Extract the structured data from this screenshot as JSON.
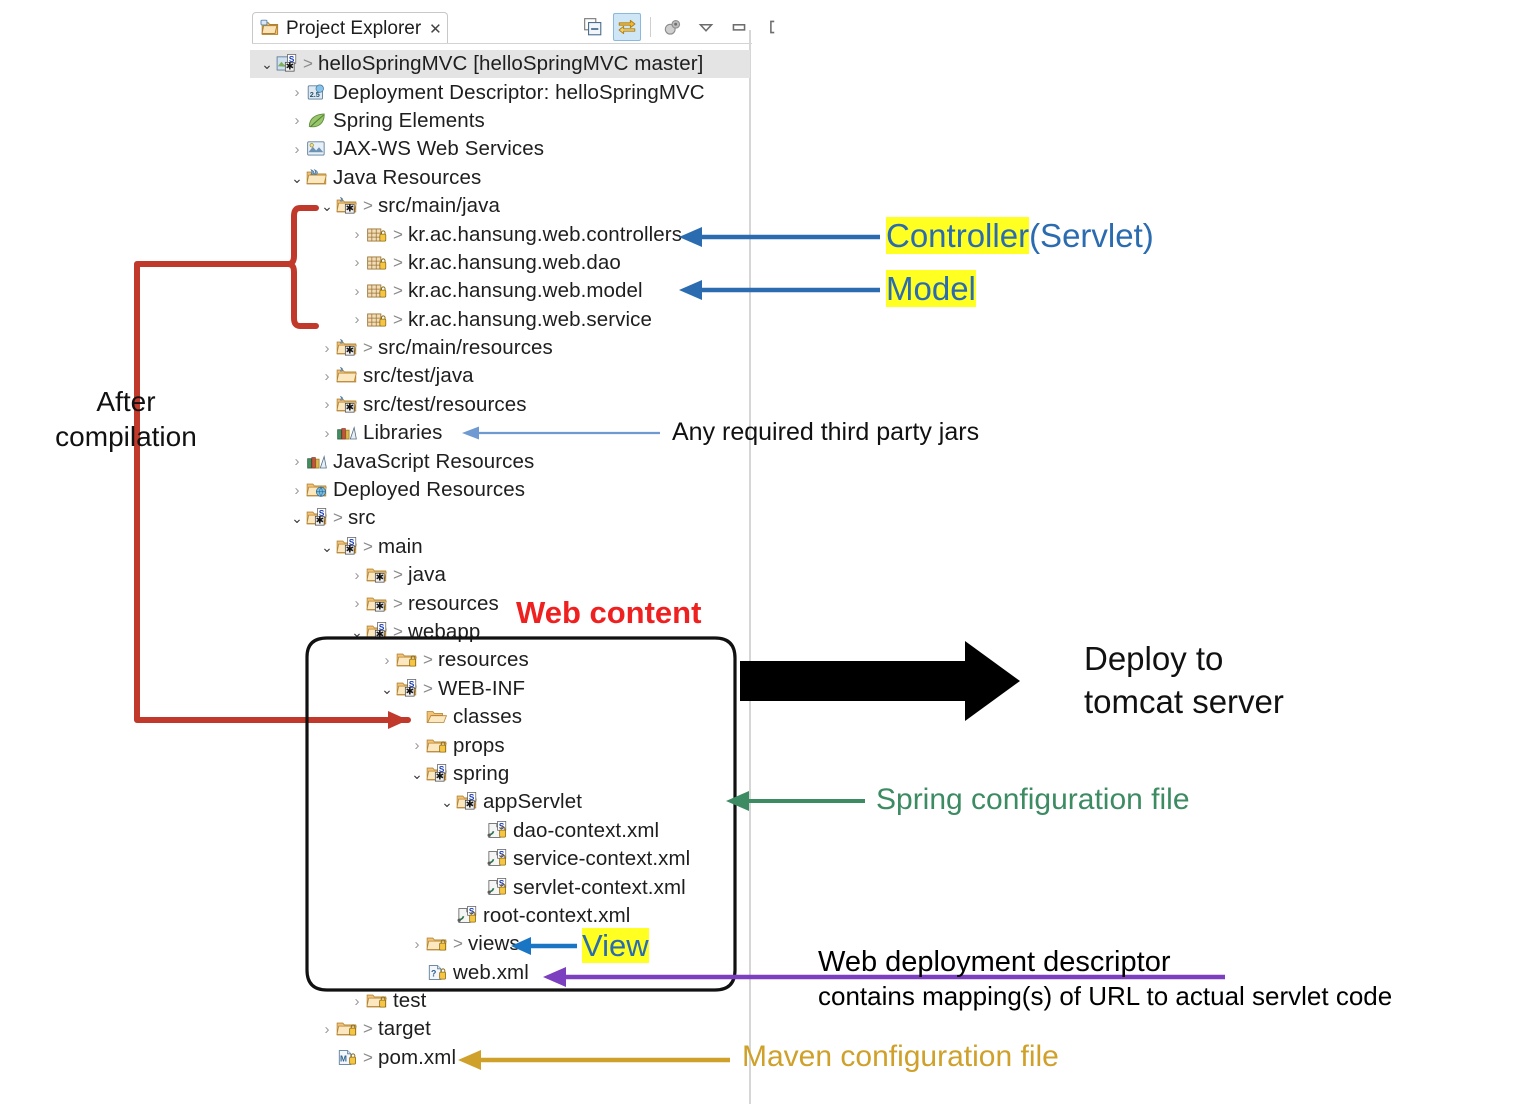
{
  "view": {
    "tab_title": "Project Explorer",
    "tab_close": "✕",
    "tab_icon": "project-explorer-icon",
    "toolbar": [
      {
        "name": "collapse-all-icon",
        "label": "Collapse All",
        "active": false
      },
      {
        "name": "link-with-editor-icon",
        "label": "Link with Editor",
        "active": true
      },
      {
        "name": "focus-on-active-task-icon",
        "label": "Focus on Active Task",
        "active": false
      },
      {
        "name": "view-menu-icon",
        "label": "View Menu",
        "active": false
      },
      {
        "name": "minimize-icon",
        "label": "Minimize",
        "active": false
      },
      {
        "name": "maximize-icon",
        "label": "Maximize",
        "active": false
      }
    ]
  },
  "tree": [
    {
      "indent": 0,
      "tw": "v",
      "icon": "spring-project-icon",
      "gt": true,
      "label": "helloSpringMVC  [helloSpringMVC master]",
      "state": "selected"
    },
    {
      "indent": 1,
      "tw": ">",
      "icon": "deployment-descriptor-icon",
      "gt": false,
      "label": "Deployment Descriptor: helloSpringMVC"
    },
    {
      "indent": 1,
      "tw": ">",
      "icon": "spring-leaf-icon",
      "gt": false,
      "label": "Spring Elements"
    },
    {
      "indent": 1,
      "tw": ">",
      "icon": "jaxws-icon",
      "gt": false,
      "label": "JAX-WS Web Services"
    },
    {
      "indent": 1,
      "tw": "v",
      "icon": "java-resources-icon",
      "gt": false,
      "label": "Java Resources"
    },
    {
      "indent": 2,
      "tw": "v",
      "icon": "source-folder-icon",
      "gt": true,
      "label": "src/main/java"
    },
    {
      "indent": 3,
      "tw": ">",
      "icon": "package-icon",
      "gt": true,
      "label": "kr.ac.hansung.web.controllers",
      "box": "red"
    },
    {
      "indent": 3,
      "tw": ">",
      "icon": "package-icon",
      "gt": true,
      "label": "kr.ac.hansung.web.dao"
    },
    {
      "indent": 3,
      "tw": ">",
      "icon": "package-icon",
      "gt": true,
      "label": "kr.ac.hansung.web.model",
      "box": "red"
    },
    {
      "indent": 3,
      "tw": ">",
      "icon": "package-icon",
      "gt": true,
      "label": "kr.ac.hansung.web.service"
    },
    {
      "indent": 2,
      "tw": ">",
      "icon": "source-folder-icon",
      "gt": true,
      "label": "src/main/resources"
    },
    {
      "indent": 2,
      "tw": ">",
      "icon": "folder-plain-icon",
      "gt": false,
      "label": "src/test/java"
    },
    {
      "indent": 2,
      "tw": ">",
      "icon": "source-folder-icon",
      "gt": false,
      "label": "src/test/resources"
    },
    {
      "indent": 2,
      "tw": ">",
      "icon": "libraries-icon",
      "gt": false,
      "label": "Libraries",
      "box": "navy"
    },
    {
      "indent": 1,
      "tw": ">",
      "icon": "libraries-icon",
      "gt": false,
      "label": "JavaScript Resources"
    },
    {
      "indent": 1,
      "tw": ">",
      "icon": "deployed-resources-icon",
      "gt": false,
      "label": "Deployed Resources"
    },
    {
      "indent": 1,
      "tw": "v",
      "icon": "folder-spring-icon",
      "gt": true,
      "label": "src"
    },
    {
      "indent": 2,
      "tw": "v",
      "icon": "folder-spring-icon",
      "gt": true,
      "label": "main"
    },
    {
      "indent": 3,
      "tw": ">",
      "icon": "folder-java-icon",
      "gt": true,
      "label": "java"
    },
    {
      "indent": 3,
      "tw": ">",
      "icon": "folder-java-icon",
      "gt": true,
      "label": "resources"
    },
    {
      "indent": 3,
      "tw": "v",
      "icon": "folder-spring-icon",
      "gt": true,
      "label": "webapp"
    },
    {
      "indent": 4,
      "tw": ">",
      "icon": "folder-lock-icon",
      "gt": true,
      "label": "resources"
    },
    {
      "indent": 4,
      "tw": "v",
      "icon": "folder-spring-icon",
      "gt": true,
      "label": "WEB-INF"
    },
    {
      "indent": 5,
      "tw": "",
      "icon": "folder-open-icon",
      "gt": false,
      "label": "classes",
      "box": "red"
    },
    {
      "indent": 5,
      "tw": ">",
      "icon": "folder-lock-icon",
      "gt": false,
      "label": "props"
    },
    {
      "indent": 5,
      "tw": "v",
      "icon": "folder-spring-icon",
      "gt": false,
      "label": "spring"
    },
    {
      "indent": 6,
      "tw": "v",
      "icon": "folder-spring-icon",
      "gt": false,
      "label": "appServlet"
    },
    {
      "indent": 7,
      "tw": "",
      "icon": "spring-xml-icon",
      "gt": false,
      "label": "dao-context.xml"
    },
    {
      "indent": 7,
      "tw": "",
      "icon": "spring-xml-icon",
      "gt": false,
      "label": "service-context.xml"
    },
    {
      "indent": 7,
      "tw": "",
      "icon": "spring-xml-icon",
      "gt": false,
      "label": "servlet-context.xml"
    },
    {
      "indent": 6,
      "tw": "",
      "icon": "spring-xml-icon",
      "gt": false,
      "label": "root-context.xml"
    },
    {
      "indent": 5,
      "tw": ">",
      "icon": "folder-lock-icon",
      "gt": true,
      "label": "views",
      "box": "cyan"
    },
    {
      "indent": 5,
      "tw": "",
      "icon": "web-xml-icon",
      "gt": false,
      "label": "web.xml",
      "box": "purple"
    },
    {
      "indent": 3,
      "tw": ">",
      "icon": "folder-lock-icon",
      "gt": false,
      "label": "test"
    },
    {
      "indent": 2,
      "tw": ">",
      "icon": "folder-lock-icon",
      "gt": true,
      "label": "target"
    },
    {
      "indent": 2,
      "tw": "",
      "icon": "pom-xml-icon",
      "gt": true,
      "label": "pom.xml",
      "box": "gold"
    }
  ],
  "annotations": {
    "controller": {
      "mark": "Controller",
      "rest": "(Servlet)"
    },
    "model": {
      "mark": "Model",
      "rest": ""
    },
    "libraries_note": "Any required third party jars",
    "after_compilation": {
      "line1": "After",
      "line2": "compilation"
    },
    "web_content": "Web content",
    "deploy": {
      "line1": "Deploy to",
      "line2": "tomcat server"
    },
    "spring_config": "Spring configuration file",
    "view": "View",
    "web_descriptor": {
      "title": "Web deployment descriptor",
      "subtitle": "contains mapping(s) of URL to actual servlet code"
    },
    "maven_config": "Maven configuration file"
  },
  "colors": {
    "red": "#c0392b",
    "blue": "#2b6cb0",
    "green": "#3d8b62",
    "purple": "#7b3fbf",
    "gold": "#cfa02a",
    "black": "#000000",
    "highlight": "#ffff21"
  }
}
